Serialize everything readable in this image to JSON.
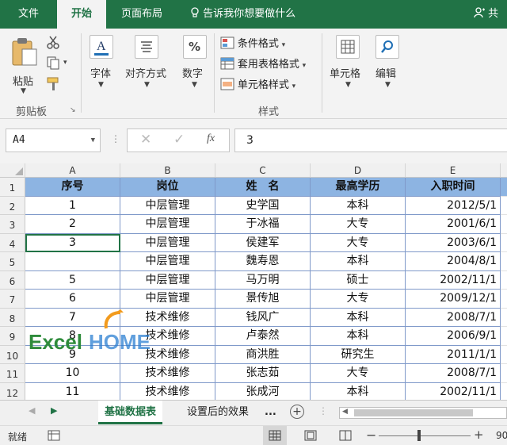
{
  "ribbon_tabs": [
    "文件",
    "开始",
    "页面布局"
  ],
  "tell_me": "告诉我你想要做什么",
  "share_label": "共",
  "clipboard": {
    "paste": "粘贴",
    "group": "剪贴板"
  },
  "buttons": {
    "font": "字体",
    "align": "对齐方式",
    "number": "数字",
    "cells": "单元格",
    "edit": "编辑"
  },
  "styles": {
    "cond": "条件格式",
    "table": "套用表格格式",
    "cell": "单元格样式",
    "group": "样式"
  },
  "name_box": "A4",
  "formula_value": "3",
  "columns": [
    "A",
    "B",
    "C",
    "D",
    "E"
  ],
  "rows": [
    "1",
    "2",
    "3",
    "4",
    "5",
    "6",
    "7",
    "8",
    "9",
    "10",
    "11",
    "12"
  ],
  "table": {
    "header": [
      "序号",
      "岗位",
      "姓　名",
      "最高学历",
      "入职时间"
    ],
    "data": [
      [
        "1",
        "中层管理",
        "史学国",
        "本科",
        "2012/5/1"
      ],
      [
        "2",
        "中层管理",
        "于冰福",
        "大专",
        "2001/6/1"
      ],
      [
        "3",
        "中层管理",
        "侯建军",
        "大专",
        "2003/6/1"
      ],
      [
        "",
        "中层管理",
        "魏寿恩",
        "本科",
        "2004/8/1"
      ],
      [
        "5",
        "中层管理",
        "马万明",
        "硕士",
        "2002/11/1"
      ],
      [
        "6",
        "中层管理",
        "景传旭",
        "大专",
        "2009/12/1"
      ],
      [
        "7",
        "技术维修",
        "钱风广",
        "本科",
        "2008/7/1"
      ],
      [
        "8",
        "技术维修",
        "卢泰然",
        "本科",
        "2006/9/1"
      ],
      [
        "9",
        "技术维修",
        "商洪胜",
        "研究生",
        "2011/1/1"
      ],
      [
        "10",
        "技术维修",
        "张志茹",
        "大专",
        "2008/7/1"
      ],
      [
        "11",
        "技术维修",
        "张成河",
        "本科",
        "2002/11/1"
      ]
    ]
  },
  "watermark": "ExcelHOME",
  "sheet_tabs": [
    "基础数据表",
    "设置后的效果",
    "..."
  ],
  "status": {
    "ready": "就绪",
    "zoom": "90"
  },
  "colors": {
    "accent": "#217346",
    "header_fill": "#8db4e2",
    "border": "#7f99c9"
  }
}
